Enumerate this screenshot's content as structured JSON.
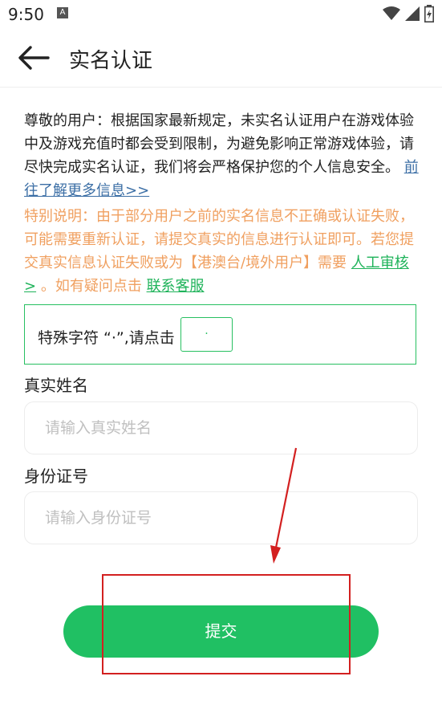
{
  "status_bar": {
    "time": "9:50",
    "notif_icon_letter": "A",
    "icons": [
      "wifi-icon",
      "cellular-signal-icon",
      "battery-charging-icon"
    ]
  },
  "header": {
    "title": "实名认证",
    "back_icon": "arrow-left-icon"
  },
  "notice": {
    "text": "尊敬的用户：根据国家最新规定，未实名认证用户在游戏体验中及游戏充值时都会受到限制，为避免影响正常游戏体验，请尽快完成实名认证，我们将会严格保护您的个人信息安全。",
    "learn_more_link": "前往了解更多信息>>"
  },
  "special_note": {
    "text": "特别说明：由于部分用户之前的实名信息不正确或认证失败，可能需要重新认证，请提交真实的信息进行认证即可。若您提交真实信息认证失败或为【港澳台/境外用户】需要",
    "manual_review_link": "人工审核>",
    "text2": "。如有疑问点击",
    "support_link": "联系客服"
  },
  "special_char_hint": {
    "text": "特殊字符 “·”,请点击",
    "button_label": "·"
  },
  "form": {
    "name_label": "真实姓名",
    "name_placeholder": "请输入真实姓名",
    "name_value": "",
    "id_label": "身份证号",
    "id_placeholder": "请输入身份证号",
    "id_value": ""
  },
  "submit_label": "提交",
  "colors": {
    "accent_green": "#20c063",
    "notice_orange": "#f0a060",
    "link_blue": "#3b6ea5",
    "annotation_red": "#d32020"
  }
}
